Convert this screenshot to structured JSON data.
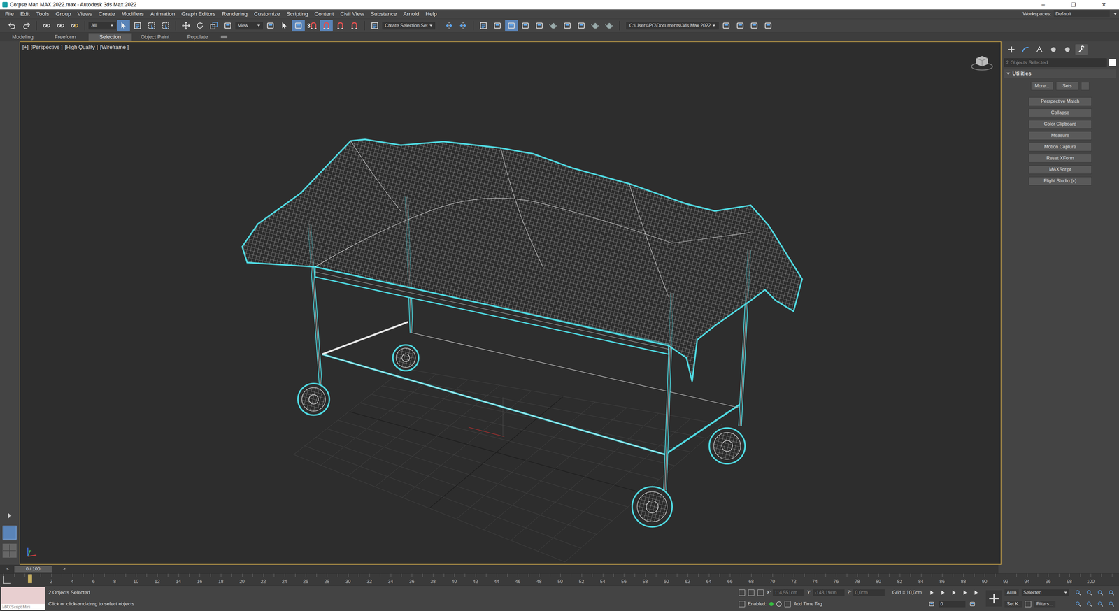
{
  "window": {
    "title": "Corpse Man MAX 2022.max - Autodesk 3ds Max 2022",
    "controls": [
      "─",
      "❐",
      "✕"
    ]
  },
  "menu": [
    "File",
    "Edit",
    "Tools",
    "Group",
    "Views",
    "Create",
    "Modifiers",
    "Animation",
    "Graph Editors",
    "Rendering",
    "Customize",
    "Scripting",
    "Content",
    "Civil View",
    "Substance",
    "Arnold",
    "Help"
  ],
  "workspaces": {
    "label": "Workspaces:",
    "value": "Default"
  },
  "toolbar": [
    {
      "kind": "undo",
      "selected": false
    },
    {
      "kind": "redo",
      "selected": false
    },
    {
      "kind": "sep"
    },
    {
      "kind": "link",
      "selected": false
    },
    {
      "kind": "unlink",
      "selected": false
    },
    {
      "kind": "bind",
      "selected": false
    },
    {
      "kind": "sep"
    },
    {
      "kind": "dropdown",
      "label": "All"
    },
    {
      "kind": "select",
      "selected": true
    },
    {
      "kind": "list",
      "selected": false
    },
    {
      "kind": "region",
      "selected": false
    },
    {
      "kind": "crossing",
      "selected": false
    },
    {
      "kind": "sep"
    },
    {
      "kind": "move",
      "selected": false
    },
    {
      "kind": "rotate",
      "selected": false
    },
    {
      "kind": "scale",
      "selected": false
    },
    {
      "kind": "place",
      "selected": false
    },
    {
      "kind": "dropdown",
      "label": "View"
    },
    {
      "kind": "pivot",
      "selected": false
    },
    {
      "kind": "manip",
      "selected": false
    },
    {
      "kind": "keyboard",
      "selected": true
    },
    {
      "kind": "snap",
      "label": "3",
      "selected": false
    },
    {
      "kind": "angle",
      "selected": true
    },
    {
      "kind": "percent",
      "selected": false
    },
    {
      "kind": "spinner",
      "selected": false
    },
    {
      "kind": "sep"
    },
    {
      "kind": "named",
      "selected": false
    },
    {
      "kind": "dropdown",
      "label": "Create Selection Set"
    },
    {
      "kind": "sep"
    },
    {
      "kind": "mirror",
      "selected": false
    },
    {
      "kind": "align",
      "selected": false
    },
    {
      "kind": "sep"
    },
    {
      "kind": "explorer",
      "selected": false
    },
    {
      "kind": "layers",
      "selected": false
    },
    {
      "kind": "ribbon",
      "selected": true
    },
    {
      "kind": "curve",
      "selected": false
    },
    {
      "kind": "schematic",
      "selected": false
    },
    {
      "kind": "material",
      "selected": false
    },
    {
      "kind": "render-setup",
      "selected": false
    },
    {
      "kind": "frame",
      "selected": false
    },
    {
      "kind": "render",
      "selected": false
    },
    {
      "kind": "teapot",
      "selected": false
    },
    {
      "kind": "sep"
    },
    {
      "kind": "path",
      "label": "C:\\Users\\PC\\Documents\\3ds Max 2022"
    },
    {
      "kind": "project",
      "selected": false
    },
    {
      "kind": "project",
      "selected": false
    },
    {
      "kind": "project",
      "selected": false
    },
    {
      "kind": "project",
      "selected": false
    }
  ],
  "ribbon_tabs": [
    {
      "label": "Modeling",
      "selected": false
    },
    {
      "label": "Freeform",
      "selected": false
    },
    {
      "label": "Selection",
      "selected": true
    },
    {
      "label": "Object Paint",
      "selected": false
    },
    {
      "label": "Populate",
      "selected": false
    }
  ],
  "viewport": {
    "labels": [
      "[+]",
      "[Perspective ]",
      "[High Quality ]",
      "[Wireframe ]"
    ]
  },
  "command_panel": {
    "tabs": [
      {
        "kind": "create",
        "selected": false
      },
      {
        "kind": "modify",
        "selected": false
      },
      {
        "kind": "hierarchy",
        "selected": false
      },
      {
        "kind": "motion",
        "selected": false
      },
      {
        "kind": "display",
        "selected": false
      },
      {
        "kind": "utilities",
        "selected": true
      }
    ],
    "selection": "2 Objects Selected",
    "rollout": {
      "title": "Utilities",
      "expanded": true
    },
    "top_buttons": [
      "More...",
      "Sets"
    ],
    "buttons": [
      "Perspective Match",
      "Collapse",
      "Color Clipboard",
      "Measure",
      "Motion Capture",
      "Reset XForm",
      "MAXScript",
      "Flight Studio (c)"
    ]
  },
  "timeline": {
    "prev": "<",
    "slider": "0 / 100",
    "next": ">",
    "ticks": [
      "2",
      "4",
      "6",
      "8",
      "10",
      "12",
      "14",
      "16",
      "18",
      "20",
      "22",
      "24",
      "26",
      "28",
      "30",
      "32",
      "34",
      "36",
      "38",
      "40",
      "42",
      "44",
      "46",
      "48",
      "50",
      "52",
      "54",
      "56",
      "58",
      "60",
      "62",
      "64",
      "66",
      "68",
      "70",
      "72",
      "74",
      "76",
      "78",
      "80",
      "82",
      "84",
      "86",
      "88",
      "90",
      "92",
      "94",
      "96",
      "98",
      "100"
    ]
  },
  "status_bar": {
    "mini": "MAXScript Mini",
    "selection": "2 Objects Selected",
    "prompt": "Click or click-and-drag to select objects",
    "coords": [
      {
        "axis": "X:",
        "value": "114,551cm"
      },
      {
        "axis": "Y:",
        "value": "-143,19cm"
      },
      {
        "axis": "Z:",
        "value": "0,0cm"
      }
    ],
    "grid": "Grid = 10,0cm",
    "enabled": {
      "label": "Enabled:",
      "on": true
    },
    "add_time_tag": "Add Time Tag",
    "auto": "Auto",
    "key_mode": "Selected",
    "set_key": "Set K.",
    "filters": "Filters...",
    "frame": "0"
  }
}
